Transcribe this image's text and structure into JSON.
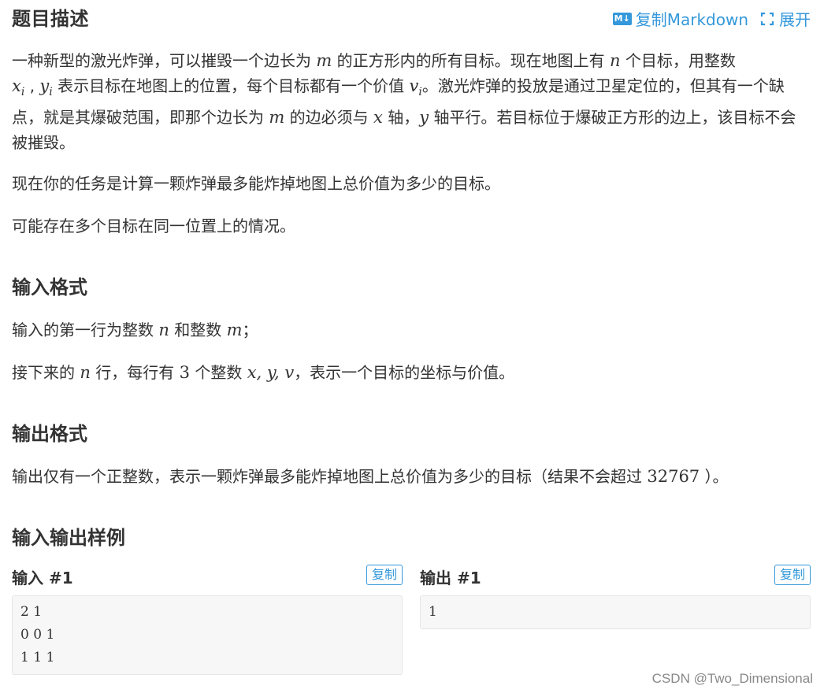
{
  "header": {
    "title": "题目描述",
    "copy_markdown": "复制Markdown",
    "expand": "展开",
    "md_badge": "M↓"
  },
  "description": {
    "p1": {
      "t1": "一种新型的激光炸弹，可以摧毁一个边长为",
      "m1": "m",
      "t2": "的正方形内的所有目标。现在地图上有",
      "n1": "n",
      "t3": "个目标，用整数",
      "xi_base": "x",
      "xi_sub": "i",
      "sep": ",",
      "yi_base": "y",
      "yi_sub": "i",
      "t4": "表示目标在地图上的位置，每个目标都有一个价值",
      "vi_base": "v",
      "vi_sub": "i",
      "t5": "。激光炸弹的投放是通过卫星定位的，但其有一个缺点，就是其爆破范围，即那个边长为",
      "m2": "m",
      "t6": "的边必须与",
      "x_axis": "x",
      "t7": "轴，",
      "y_axis": "y",
      "t8": "轴平行。若目标位于爆破正方形的边上，该目标不会被摧毁。"
    },
    "p2": "现在你的任务是计算一颗炸弹最多能炸掉地图上总价值为多少的目标。",
    "p3": "可能存在多个目标在同一位置上的情况。"
  },
  "input_format": {
    "title": "输入格式",
    "l1": {
      "t1": "输入的第一行为整数",
      "n": "n",
      "t2": "和整数",
      "m": "m",
      "t3": "；"
    },
    "l2": {
      "t1": "接下来的",
      "n": "n",
      "t2": "行，每行有",
      "three": "3",
      "t3": "个整数",
      "vars": "x, y, v",
      "t4": "，表示一个目标的坐标与价值。"
    }
  },
  "output_format": {
    "title": "输出格式",
    "t1": "输出仅有一个正整数，表示一颗炸弹最多能炸掉地图上总价值为多少的目标（结果不会超过",
    "limit": "32767",
    "t2": "）。"
  },
  "samples": {
    "title": "输入输出样例",
    "input": {
      "title": "输入 #1",
      "copy": "复制",
      "content": "2 1\n0 0 1\n1 1 1"
    },
    "output": {
      "title": "输出 #1",
      "copy": "复制",
      "content": "1"
    }
  },
  "watermark": "CSDN @Two_Dimensional",
  "colors": {
    "accent": "#3498db",
    "text": "#333333",
    "code_bg": "#f7f7f7"
  }
}
